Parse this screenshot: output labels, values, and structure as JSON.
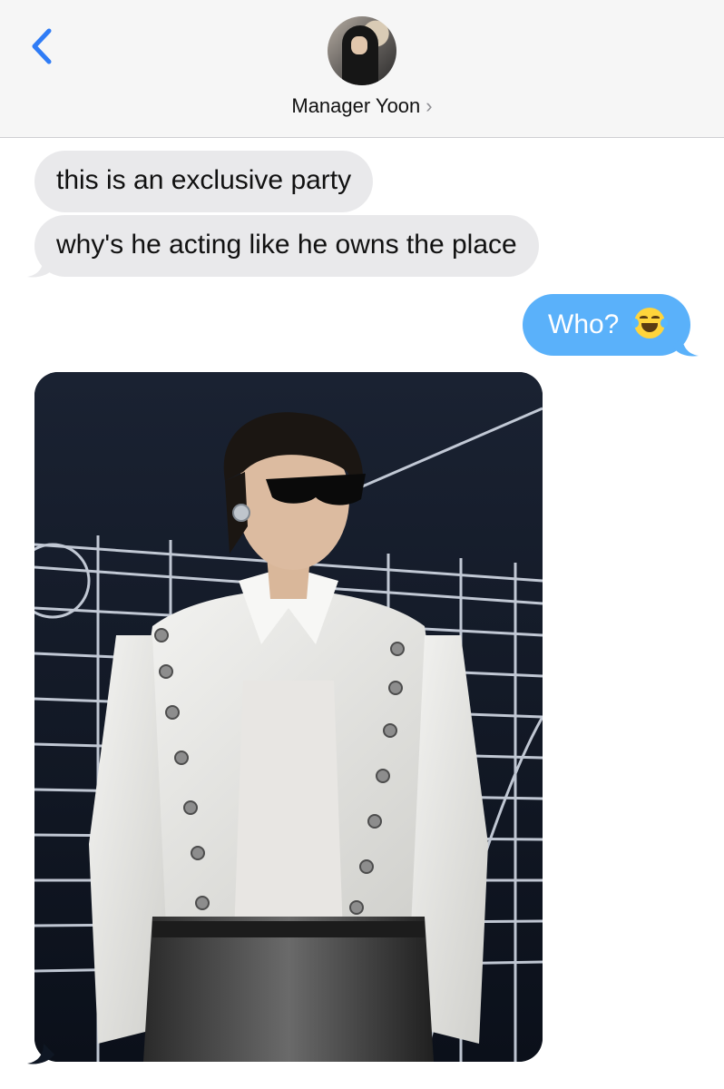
{
  "header": {
    "contact_name": "Manager Yoon",
    "chevron": "›",
    "back_icon": "chevron-left-icon",
    "avatar": "contact-avatar"
  },
  "messages": [
    {
      "direction": "received",
      "text": "this is an exclusive party"
    },
    {
      "direction": "received",
      "text": "why's he acting like he owns the place"
    },
    {
      "direction": "sent",
      "text": "Who?",
      "emoji": "face-with-tears-of-joy-icon"
    },
    {
      "direction": "received",
      "type": "photo",
      "description": "performer-photo"
    }
  ],
  "colors": {
    "sent_bubble": "#5ab1fa",
    "received_bubble": "#e9e9eb",
    "accent": "#2f7cf6",
    "header_bg": "#f6f6f6"
  }
}
